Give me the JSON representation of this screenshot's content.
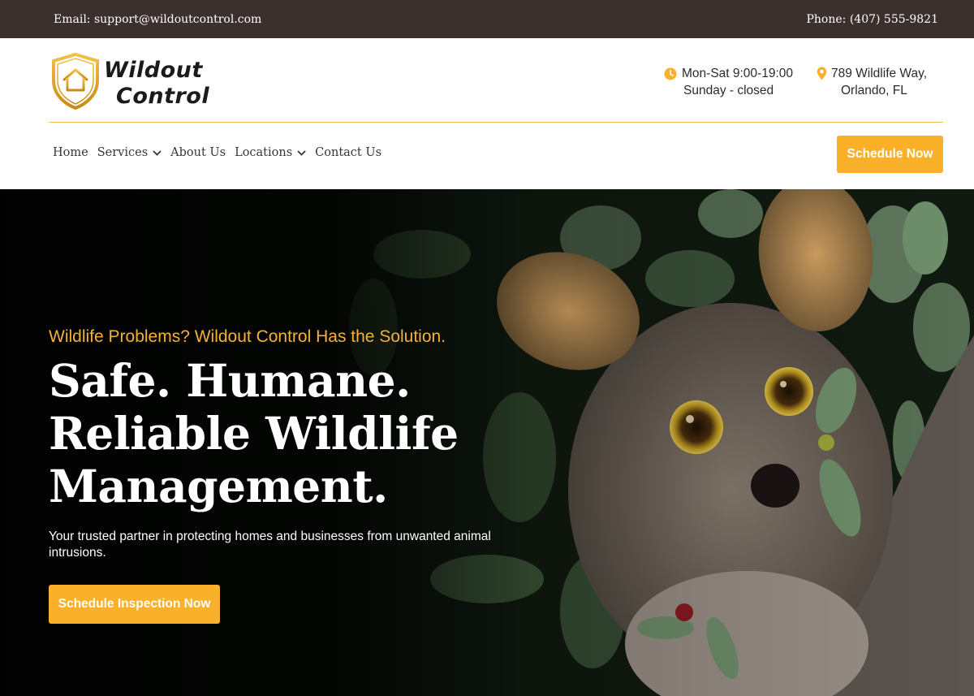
{
  "topbar": {
    "email": "Email: support@wildoutcontrol.com",
    "phone": "Phone: (407) 555-9821"
  },
  "brand": {
    "line1": "Wildout",
    "line2": "Control",
    "accent_color": "#fbb02a",
    "dark_color": "#3b302d"
  },
  "contact": {
    "hours_line1": "Mon-Sat 9:00-19:00",
    "hours_line2": "Sunday - closed",
    "hours_icon": "clock-icon",
    "address_line1": "789 Wildlife Way,",
    "address_line2": "Orlando, FL",
    "address_icon": "map-pin-icon"
  },
  "nav": {
    "items": [
      {
        "label": "Home",
        "dropdown": false
      },
      {
        "label": "Services",
        "dropdown": true
      },
      {
        "label": "About Us",
        "dropdown": false
      },
      {
        "label": "Locations",
        "dropdown": true
      },
      {
        "label": "Contact Us",
        "dropdown": false
      }
    ],
    "cta_label": "Schedule Now"
  },
  "hero": {
    "tagline": "Wildlife Problems? Wildout Control Has the Solution.",
    "headline": "Safe. Humane. Reliable Wildlife Management.",
    "subtext": "Your trusted partner in protecting homes and businesses from unwanted animal intrusions.",
    "cta_label": "Schedule Inspection Now"
  }
}
